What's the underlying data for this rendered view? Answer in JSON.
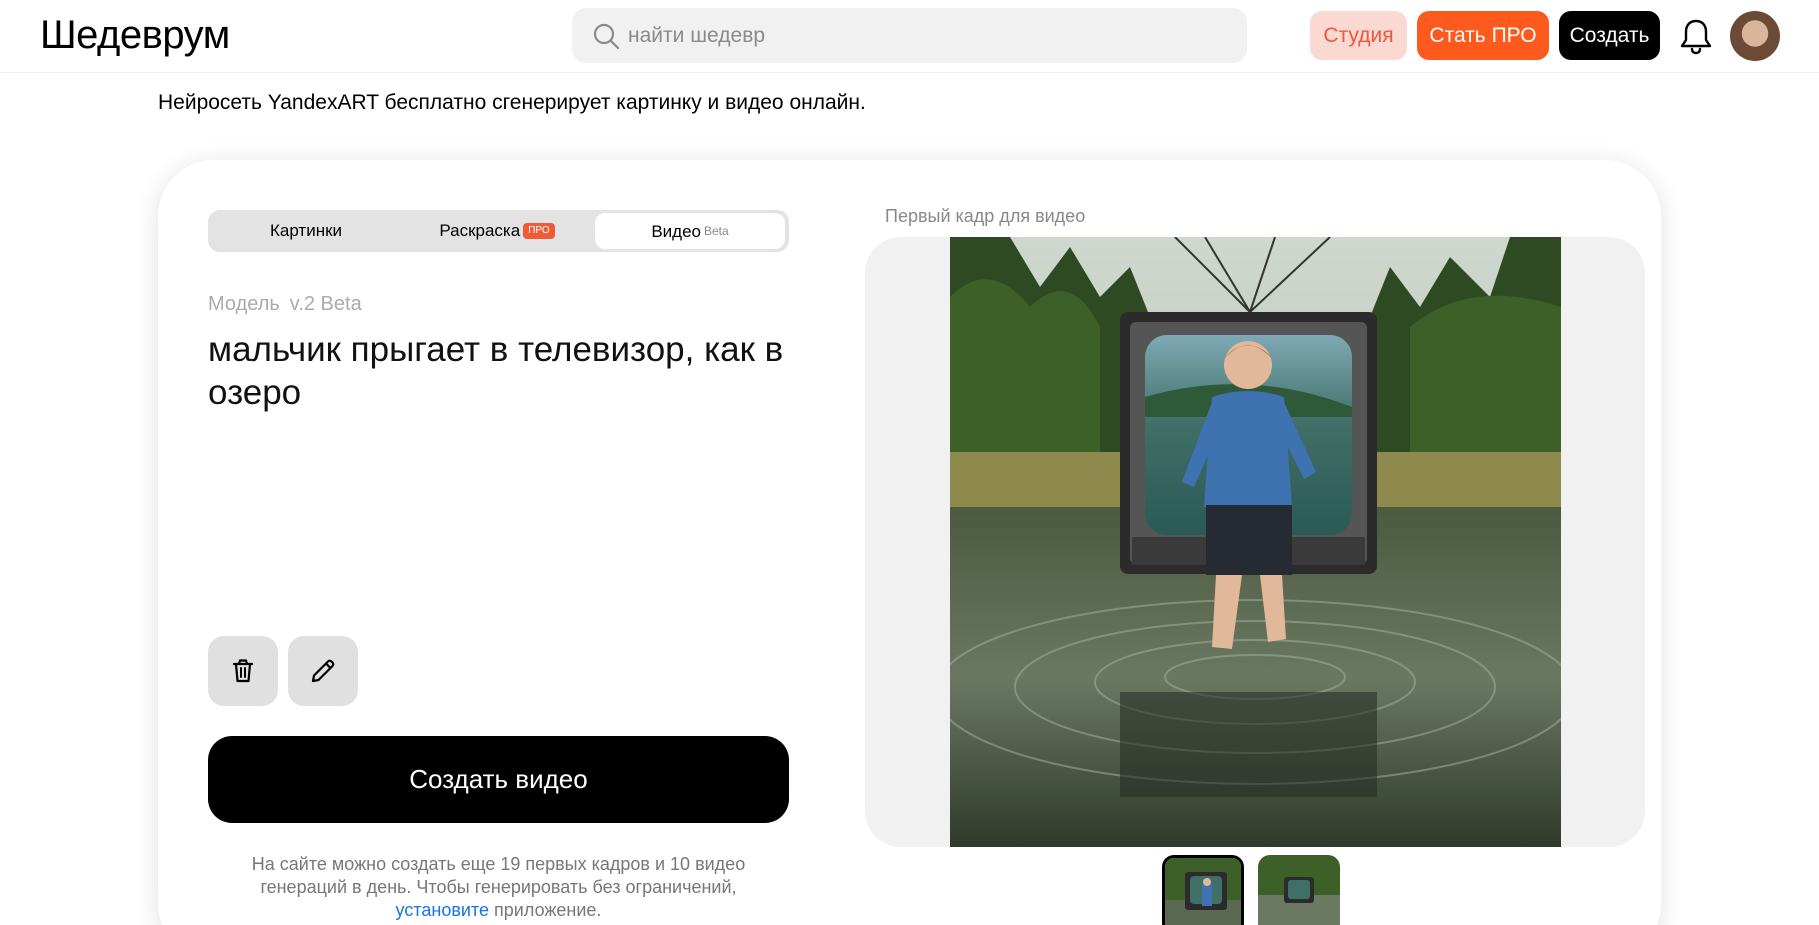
{
  "header": {
    "logo": "Шедеврум",
    "search_placeholder": "найти шедевр",
    "studio_label": "Студия",
    "pro_label": "Стать ПРО",
    "create_label": "Создать"
  },
  "subtitle": "Нейросеть YandexART бесплатно сгенерирует картинку и видео онлайн.",
  "tabs": [
    {
      "label": "Картинки"
    },
    {
      "label": "Раскраска",
      "badge": "ПРО"
    },
    {
      "label": "Видео",
      "badge": "Beta",
      "active": true
    }
  ],
  "model": {
    "label": "Модель",
    "value": "v.2 Beta"
  },
  "prompt": "мальчик прыгает в телевизор, как в озеро",
  "actions": {
    "delete_icon": "trash-icon",
    "edit_icon": "pencil-icon"
  },
  "create_video_label": "Создать видео",
  "note": {
    "before": "На сайте можно создать еще 19 первых кадров и 10 видео генераций в день. Чтобы генерировать без ограничений,",
    "link": "установите",
    "after": "приложение."
  },
  "preview": {
    "label": "Первый кадр для видео"
  },
  "colors": {
    "accent_orange": "#fe5a1d",
    "studio_bg": "#fbd9d3",
    "studio_text": "#f0563a",
    "link": "#1a73e8"
  }
}
